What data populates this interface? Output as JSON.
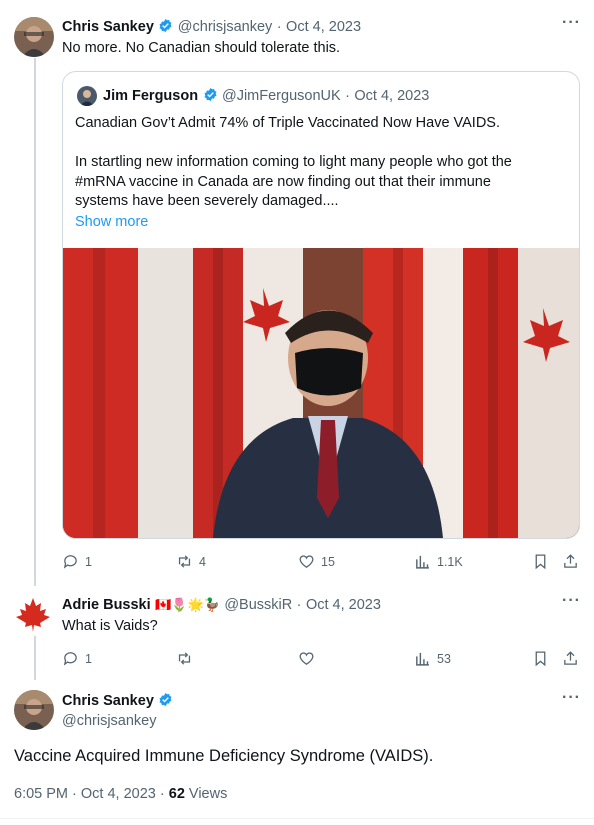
{
  "colors": {
    "accent": "#1d9bf0",
    "muted": "#536471",
    "border": "#cfd9de",
    "canada_red": "#d52b1e"
  },
  "post1": {
    "author_name": "Chris Sankey",
    "handle": "@chrisjsankey",
    "sep": "·",
    "date": "Oct 4, 2023",
    "text": "No more. No Canadian should tolerate this.",
    "more_icon": "more-horizontal-icon",
    "quote": {
      "author_name": "Jim Ferguson",
      "handle": "@JimFergusonUK",
      "sep": "·",
      "date": "Oct 4, 2023",
      "title_line": "Canadian Gov’t Admit 74% of Triple Vaccinated Now Have VAIDS.",
      "body_line1": "In startling new information coming to light many people who got the",
      "body_line2": "#mRNA vaccine in Canada are now finding out that their immune",
      "body_line3": "systems have been severely damaged....",
      "show_more": "Show more"
    },
    "actions": {
      "replies": "1",
      "reposts": "4",
      "likes": "15",
      "views": "1.1K"
    }
  },
  "reply1": {
    "author_name": "Adrie Busski",
    "emojis": "🇨🇦🌷🌟🦆",
    "handle": "@BusskiR",
    "sep": "·",
    "date": "Oct 4, 2023",
    "text": "What is Vaids?",
    "actions": {
      "replies": "1",
      "reposts": "",
      "likes": "",
      "views": "53"
    }
  },
  "focused": {
    "author_name": "Chris Sankey",
    "handle": "@chrisjsankey",
    "text": "Vaccine Acquired Immune Deficiency Syndrome (VAIDS).",
    "time": "6:05 PM · Oct 4, 2023 · ",
    "views_count": "62",
    "views_label": " Views"
  }
}
